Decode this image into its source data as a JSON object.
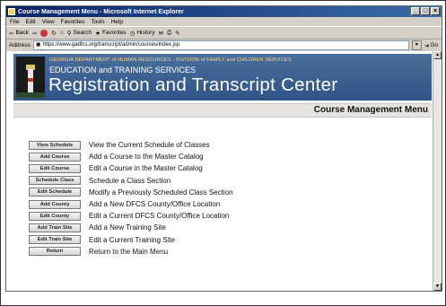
{
  "browser": {
    "window_title": "Course Management Menu - Microsoft Internet Explorer",
    "menus": [
      "File",
      "Edit",
      "View",
      "Favorites",
      "Tools",
      "Help"
    ],
    "toolbar": {
      "back": "Back",
      "search": "Search",
      "favorites": "Favorites",
      "history": "History"
    },
    "address_label": "Address",
    "address_url": "https://www.gadfcs.org/transcript/admin/courses/index.jsp",
    "go_label": "Go"
  },
  "banner": {
    "dept": "GEORGIA DEPARTMENT of HUMAN RESOURCES - DIVISION of FAMILY and CHILDREN SERVICES",
    "edu": "EDUCATION and TRAINING SERVICES",
    "main": "Registration and Transcript Center"
  },
  "page_title": "Course Management Menu",
  "items": [
    {
      "button": "View Schedule",
      "desc": "View the Current Schedule of Classes"
    },
    {
      "button": "Add Course",
      "desc": "Add a Course to the Master Catalog"
    },
    {
      "button": "Edit Course",
      "desc": "Edit a Course in the Master Catalog"
    },
    {
      "button": "Schedule Class",
      "desc": "Schedule a Class Section"
    },
    {
      "button": "Edit Schedule",
      "desc": "Modify a Previously Scheduled Class Section"
    },
    {
      "button": "Add County",
      "desc": "Add a New DFCS County/Office Location"
    },
    {
      "button": "Edit County",
      "desc": "Edit a Current DFCS County/Office Location"
    },
    {
      "button": "Add Train Site",
      "desc": "Add a New Training Site"
    },
    {
      "button": "Edit Train Site",
      "desc": "Edit a Current Training Site"
    },
    {
      "button": "Return",
      "desc": "Return to the Main Menu"
    }
  ]
}
